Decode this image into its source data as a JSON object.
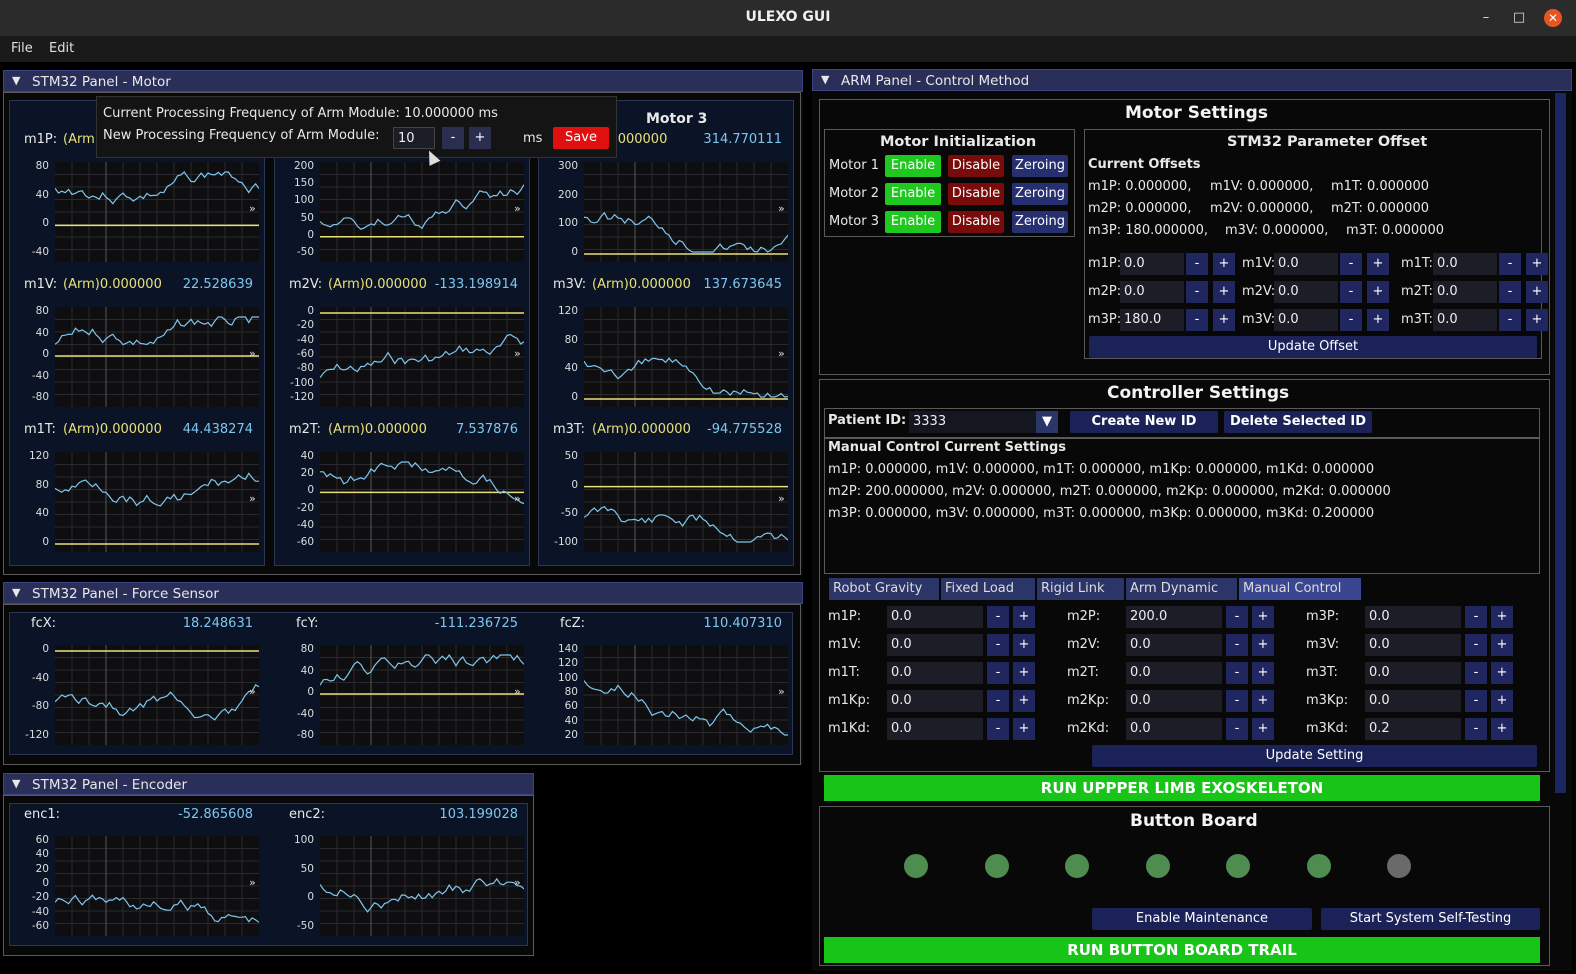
{
  "window": {
    "title": "ULEXO GUI",
    "min": "–",
    "max": "□",
    "close": "✕"
  },
  "menu": {
    "file": "File",
    "edit": "Edit"
  },
  "motor_panel": {
    "title": "STM32 Panel - Motor",
    "motor3_header": "Motor 3",
    "rows": [
      {
        "label": "m1P:",
        "arm": "(Arm)0.000000",
        "value": "",
        "yticks": [
          "80",
          "40",
          "0",
          "-40"
        ]
      },
      {
        "label": "m2P:",
        "arm": "",
        "value": "",
        "yticks": [
          "200",
          "150",
          "100",
          "50",
          "0",
          "-50"
        ]
      },
      {
        "label": "m3P:",
        "arm": "n)0.000000",
        "value": "314.770111",
        "yticks": [
          "300",
          "200",
          "100",
          "0"
        ]
      },
      {
        "label": "m1V:",
        "arm": "(Arm)0.000000",
        "value": "22.528639",
        "yticks": [
          "80",
          "40",
          "0",
          "-40",
          "-80"
        ]
      },
      {
        "label": "m2V:",
        "arm": "(Arm)0.000000",
        "value": "-133.198914",
        "yticks": [
          "0",
          "-20",
          "-40",
          "-60",
          "-80",
          "-100",
          "-120"
        ]
      },
      {
        "label": "m3V:",
        "arm": "(Arm)0.000000",
        "value": "137.673645",
        "yticks": [
          "120",
          "80",
          "40",
          "0"
        ]
      },
      {
        "label": "m1T:",
        "arm": "(Arm)0.000000",
        "value": "44.438274",
        "yticks": [
          "120",
          "80",
          "40",
          "0"
        ]
      },
      {
        "label": "m2T:",
        "arm": "(Arm)0.000000",
        "value": "7.537876",
        "yticks": [
          "40",
          "20",
          "0",
          "-20",
          "-40",
          "-60"
        ]
      },
      {
        "label": "m3T:",
        "arm": "(Arm)0.000000",
        "value": "-94.775528",
        "yticks": [
          "50",
          "0",
          "-50",
          "-100"
        ]
      }
    ]
  },
  "popup": {
    "current_label": "Current Processing Frequency of Arm Module: 10.000000 ms",
    "new_label": "New Processing Frequency of Arm Module:",
    "input": "10",
    "minus": "-",
    "plus": "+",
    "unit": "ms",
    "save": "Save"
  },
  "force_panel": {
    "title": "STM32 Panel - Force Sensor",
    "plots": [
      {
        "label": "fcX:",
        "value": "18.248631",
        "yticks": [
          "0",
          "-40",
          "-80",
          "-120"
        ]
      },
      {
        "label": "fcY:",
        "value": "-111.236725",
        "yticks": [
          "80",
          "40",
          "0",
          "-40",
          "-80"
        ]
      },
      {
        "label": "fcZ:",
        "value": "110.407310",
        "yticks": [
          "140",
          "120",
          "100",
          "80",
          "60",
          "40",
          "20"
        ]
      }
    ]
  },
  "encoder_panel": {
    "title": "STM32 Panel - Encoder",
    "plots": [
      {
        "label": "enc1:",
        "value": "-52.865608",
        "yticks": [
          "60",
          "40",
          "20",
          "0",
          "-20",
          "-40",
          "-60"
        ]
      },
      {
        "label": "enc2:",
        "value": "103.199028",
        "yticks": [
          "100",
          "50",
          "0",
          "-50"
        ]
      }
    ]
  },
  "arm_panel": {
    "title": "ARM Panel - Control Method",
    "motor_settings": "Motor Settings",
    "init": {
      "title": "Motor Initialization",
      "motors": [
        "Motor 1",
        "Motor 2",
        "Motor 3"
      ],
      "enable": "Enable",
      "disable": "Disable",
      "zeroing": "Zeroing"
    },
    "offset": {
      "title": "STM32 Parameter Offset",
      "current_title": "Current Offsets",
      "lines": [
        [
          "m1P: 0.000000,",
          "m1V: 0.000000,",
          "m1T: 0.000000"
        ],
        [
          "m2P: 0.000000,",
          "m2V: 0.000000,",
          "m2T: 0.000000"
        ],
        [
          "m3P: 180.000000,",
          "m3V: 0.000000,",
          "m3T: 0.000000"
        ]
      ],
      "inputs": [
        [
          "m1P:",
          "0.0",
          "m1V:",
          "0.0",
          "m1T:",
          "0.0"
        ],
        [
          "m2P:",
          "0.0",
          "m2V:",
          "0.0",
          "m2T:",
          "0.0"
        ],
        [
          "m3P:",
          "180.0",
          "m3V:",
          "0.0",
          "m3T:",
          "0.0"
        ]
      ],
      "update": "Update Offset"
    },
    "controller": {
      "title": "Controller Settings",
      "patient_label": "Patient ID:",
      "patient_id": "3333",
      "create": "Create New ID",
      "delete": "Delete Selected ID",
      "manual_title": "Manual Control Current Settings",
      "lines": [
        "m1P: 0.000000, m1V: 0.000000, m1T: 0.000000, m1Kp: 0.000000, m1Kd: 0.000000",
        "m2P: 200.000000, m2V: 0.000000, m2T: 0.000000, m2Kp: 0.000000, m2Kd: 0.000000",
        "m3P: 0.000000, m3V: 0.000000, m3T: 0.000000, m3Kp: 0.000000, m3Kd: 0.200000"
      ],
      "tabs": [
        "Robot Gravity",
        "Fixed Load",
        "Rigid Link",
        "Arm Dynamic",
        "Manual Control"
      ],
      "fields": [
        [
          [
            "m1P:",
            "0.0"
          ],
          [
            "m2P:",
            "200.0"
          ],
          [
            "m3P:",
            "0.0"
          ]
        ],
        [
          [
            "m1V:",
            "0.0"
          ],
          [
            "m2V:",
            "0.0"
          ],
          [
            "m3V:",
            "0.0"
          ]
        ],
        [
          [
            "m1T:",
            "0.0"
          ],
          [
            "m2T:",
            "0.0"
          ],
          [
            "m3T:",
            "0.0"
          ]
        ],
        [
          [
            "m1Kp:",
            "0.0"
          ],
          [
            "m2Kp:",
            "0.0"
          ],
          [
            "m3Kp:",
            "0.0"
          ]
        ],
        [
          [
            "m1Kd:",
            "0.0"
          ],
          [
            "m2Kd:",
            "0.0"
          ],
          [
            "m3Kd:",
            "0.2"
          ]
        ]
      ],
      "update": "Update Setting"
    },
    "run_exo": "RUN UPPPER LIMB EXOSKELETON",
    "button_board": {
      "title": "Button Board",
      "leds": [
        1,
        1,
        1,
        1,
        1,
        1,
        0
      ],
      "maintenance": "Enable Maintenance",
      "self_test": "Start System Self-Testing"
    },
    "run_trail": "RUN BUTTON BOARD TRAIL"
  },
  "colors": {
    "accent": "#1fc81f",
    "trace": "#7ec6ef",
    "zero_line": "#e8e07a",
    "header": "#2a2f5a"
  }
}
